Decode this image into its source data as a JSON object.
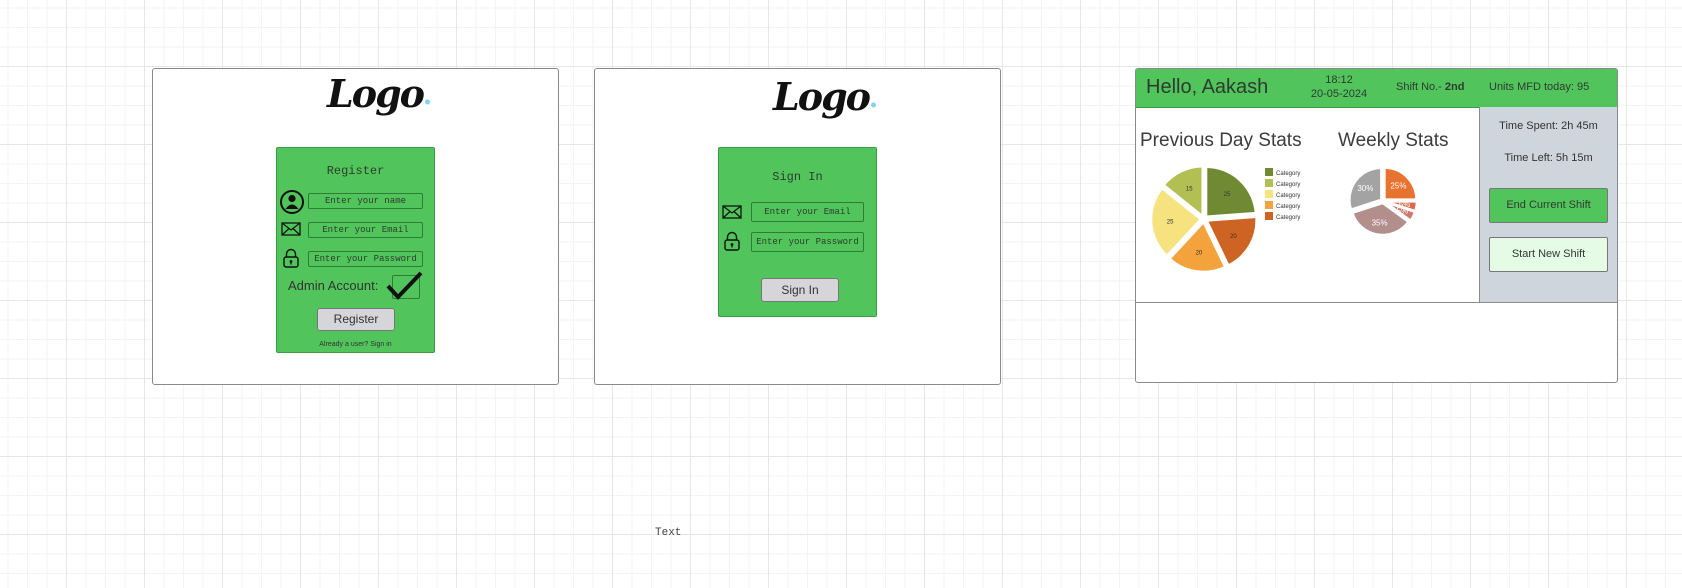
{
  "register": {
    "logo": "Logo",
    "title": "Register",
    "name_placeholder": "Enter your name",
    "email_placeholder": "Enter your Email",
    "password_placeholder": "Enter your Password",
    "admin_label": "Admin Account:",
    "button": "Register",
    "footer_link": "Already a user? Sign in"
  },
  "signin": {
    "logo": "Logo",
    "title": "Sign In",
    "email_placeholder": "Enter your Email",
    "password_placeholder": "Enter your Password",
    "button": "Sign In"
  },
  "dashboard": {
    "greeting": "Hello, Aakash",
    "time": "18:12",
    "date": "20-05-2024",
    "shift_label": "Shift No.- ",
    "shift_value": "2nd",
    "units": "Units MFD today: 95",
    "prev_title": "Previous Day Stats",
    "weekly_title": "Weekly Stats",
    "time_spent": "Time Spent: 2h 45m",
    "time_left": "Time Left: 5h 15m",
    "end_button": "End Current Shift",
    "start_button": "Start New Shift"
  },
  "canvas_text": "Text",
  "chart_data": [
    {
      "type": "pie",
      "title": "Previous Day Stats",
      "series": [
        {
          "values": [
            25,
            20,
            20,
            25,
            15
          ]
        }
      ],
      "labels": [
        "25",
        "20",
        "20",
        "25",
        "15"
      ],
      "legend": [
        "Category",
        "Category",
        "Category",
        "Category",
        "Category"
      ],
      "colors": [
        "#6f8a32",
        "#cd6424",
        "#f3a23c",
        "#f6e27e",
        "#b2bf52"
      ],
      "legend_colors": [
        "#6f8a32",
        "#b2bf52",
        "#f6e27e",
        "#f3a23c",
        "#cd6424"
      ],
      "legend_position": "right"
    },
    {
      "type": "pie",
      "title": "Weekly Stats",
      "series": [
        {
          "values": [
            25,
            5,
            5,
            35,
            30
          ]
        }
      ],
      "labels": [
        "25%",
        "5%",
        "5%",
        "35%",
        "30%"
      ],
      "colors": [
        "#e8732e",
        "#d86c4e",
        "#c87a6c",
        "#b28e8c",
        "#a3a3a3"
      ]
    }
  ]
}
